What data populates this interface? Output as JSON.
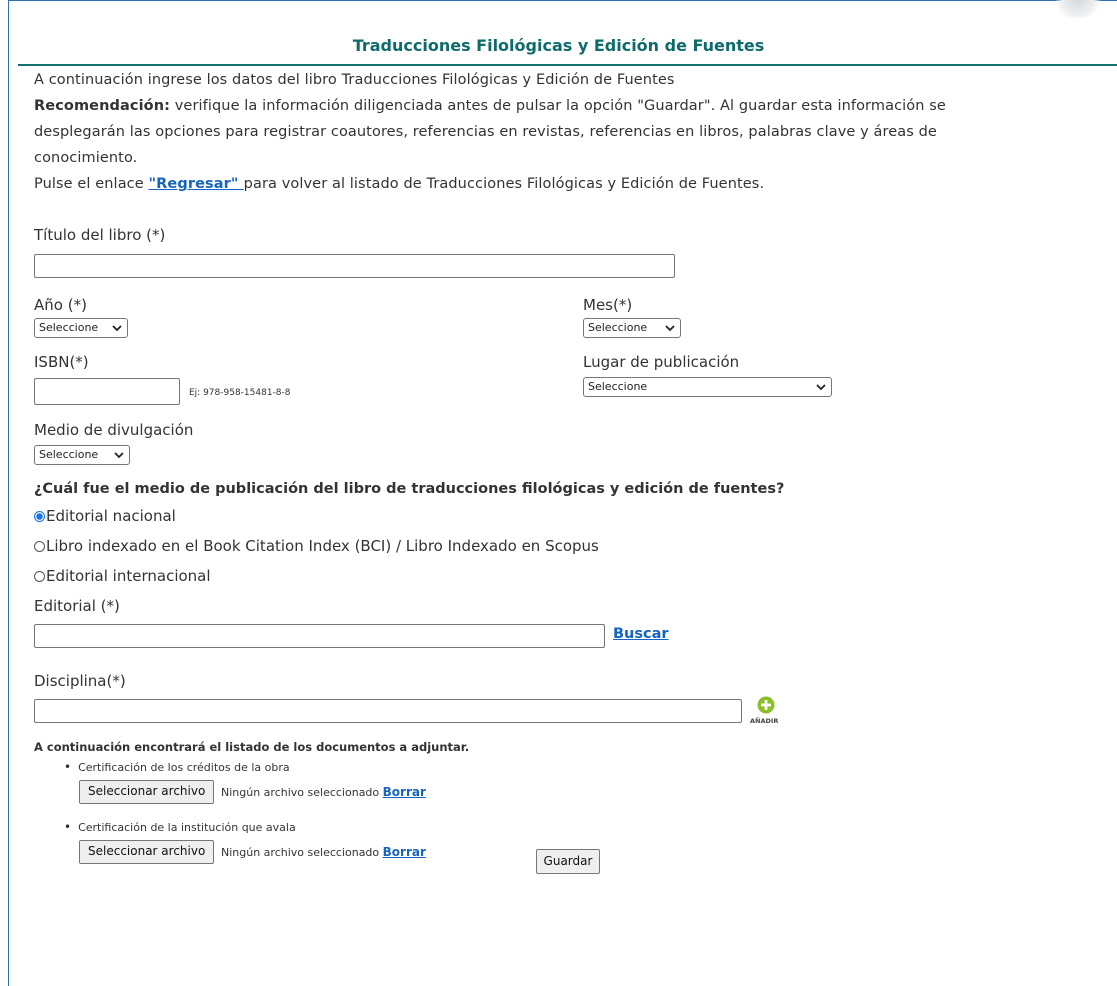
{
  "header": {
    "title": "Traducciones Filológicas y Edición de Fuentes"
  },
  "intro": {
    "line1": "A continuación ingrese los datos del libro Traducciones Filológicas y Edición de Fuentes",
    "recommendation_label": "Recomendación:",
    "recommendation_line1": " verifique la información diligenciada antes de pulsar la opción \"Guardar\". Al guardar esta información se",
    "recommendation_line2": "desplegarán las opciones para registrar coautores, referencias en revistas, referencias en libros, palabras clave y áreas de",
    "recommendation_line3": "conocimiento.",
    "back_prefix": "Pulse el enlace ",
    "back_link": "\"Regresar\" ",
    "back_suffix": "para volver al listado de Traducciones Filológicas y Edición de Fuentes."
  },
  "form": {
    "titulo_label": "Título del libro (*)",
    "titulo_value": "",
    "anio_label": "Año (*)",
    "anio_value": "Seleccione",
    "mes_label": "Mes(*)",
    "mes_value": "Seleccione",
    "isbn_label": "ISBN(*)",
    "isbn_value": "",
    "isbn_hint": "Ej: 978-958-15481-8-8",
    "lugar_label": "Lugar de publicación",
    "lugar_value": "Seleccione",
    "medio_label": "Medio de divulgación",
    "medio_value": "Seleccione",
    "question": "¿Cuál fue el medio de publicación del libro de traducciones filológicas y edición de fuentes?",
    "radio_options": [
      {
        "label": "Editorial nacional",
        "checked": true
      },
      {
        "label": "Libro indexado en el Book Citation Index (BCI) / Libro Indexado en Scopus",
        "checked": false
      },
      {
        "label": "Editorial internacional",
        "checked": false
      }
    ],
    "editorial_label": "Editorial (*)",
    "editorial_value": "",
    "buscar_link": "Buscar",
    "disciplina_label": "Disciplina(*)",
    "disciplina_value": "",
    "add_label": "AÑADIR"
  },
  "attachments": {
    "heading": "A continuación encontrará el listado de los documentos a adjuntar.",
    "items": [
      {
        "title": "Certificación de los créditos de la obra",
        "button": "Seleccionar archivo",
        "status": "Ningún archivo seleccionado",
        "delete": "Borrar"
      },
      {
        "title": "Certificación de la institución que avala",
        "button": "Seleccionar archivo",
        "status": "Ningún archivo seleccionado",
        "delete": "Borrar"
      }
    ]
  },
  "actions": {
    "save": "Guardar"
  },
  "colors": {
    "title": "#0e6b6b",
    "link": "#1565c0",
    "add_icon": "#8bbf2a"
  }
}
